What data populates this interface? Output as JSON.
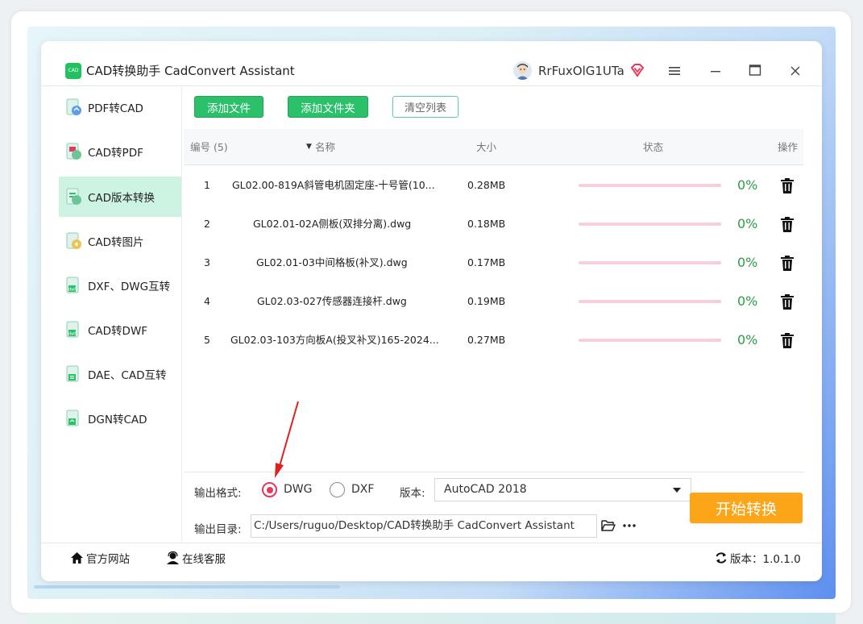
{
  "app": {
    "title": "CAD转换助手 CadConvert Assistant",
    "logo_text": "CAD",
    "username": "RrFuxOlG1UTa"
  },
  "colors": {
    "brand_green": "#2bc16a",
    "active_nav_bg": "#cdf3e2",
    "start_orange": "#fca519",
    "percent_green": "#2e9c49",
    "radio_red": "#e8365d"
  },
  "sidebar": {
    "items": [
      {
        "label": "PDF转CAD",
        "icon": "pdf-to-cad-icon"
      },
      {
        "label": "CAD转PDF",
        "icon": "cad-to-pdf-icon"
      },
      {
        "label": "CAD版本转换",
        "icon": "cad-version-icon",
        "active": true
      },
      {
        "label": "CAD转图片",
        "icon": "cad-to-image-icon"
      },
      {
        "label": "DXF、DWG互转",
        "icon": "dxf-dwg-icon"
      },
      {
        "label": "CAD转DWF",
        "icon": "cad-to-dwf-icon"
      },
      {
        "label": "DAE、CAD互转",
        "icon": "dae-cad-icon"
      },
      {
        "label": "DGN转CAD",
        "icon": "dgn-to-cad-icon"
      }
    ]
  },
  "toolbar": {
    "add_file": "添加文件",
    "add_folder": "添加文件夹",
    "clear_list": "清空列表"
  },
  "table": {
    "headers": {
      "index": "编号 (5)",
      "name": "名称",
      "size": "大小",
      "status": "状态",
      "action": "操作"
    },
    "rows": [
      {
        "index": "1",
        "name": "GL02.00-819A斜管电机固定座-十号管(10...",
        "size": "0.28MB",
        "progress": 0,
        "percent": "0%"
      },
      {
        "index": "2",
        "name": "GL02.01-02A侧板(双排分离).dwg",
        "size": "0.18MB",
        "progress": 0,
        "percent": "0%"
      },
      {
        "index": "3",
        "name": "GL02.01-03中间格板(补叉).dwg",
        "size": "0.17MB",
        "progress": 0,
        "percent": "0%"
      },
      {
        "index": "4",
        "name": "GL02.03-027传感器连接杆.dwg",
        "size": "0.19MB",
        "progress": 0,
        "percent": "0%"
      },
      {
        "index": "5",
        "name": "GL02.03-103方向板A(投叉补叉)165-2024...",
        "size": "0.27MB",
        "progress": 0,
        "percent": "0%"
      }
    ]
  },
  "output": {
    "format_label": "输出格式:",
    "format_dwg": "DWG",
    "format_dxf": "DXF",
    "version_label": "版本:",
    "version_value": "AutoCAD 2018",
    "dir_label": "输出目录:",
    "dir_value": "C:/Users/ruguo/Desktop/CAD转换助手 CadConvert Assistant",
    "start_button": "开始转换"
  },
  "footer": {
    "website": "官方网站",
    "support": "在线客服",
    "version": "版本：1.0.1.0"
  }
}
